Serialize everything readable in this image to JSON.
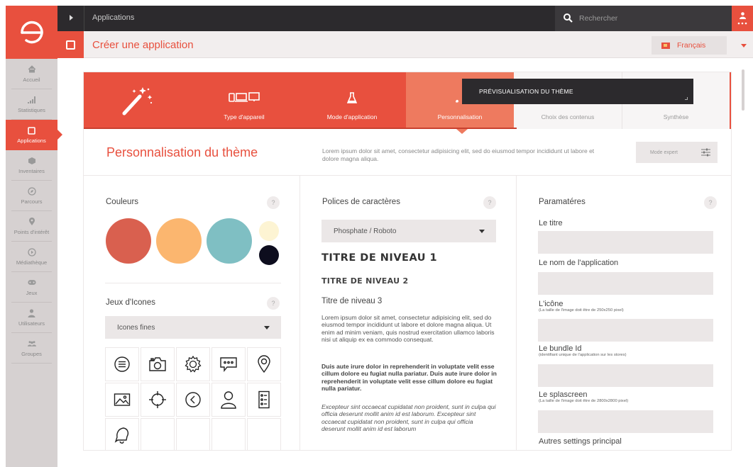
{
  "topbar": {
    "breadcrumb": "Applications",
    "search_placeholder": "Rechercher"
  },
  "subbar": {
    "title": "Créer une application",
    "language": "Français"
  },
  "sidebar": {
    "items": [
      {
        "label": "Accueil",
        "icon": "home-icon"
      },
      {
        "label": "Statistiques",
        "icon": "bar-chart-icon"
      },
      {
        "label": "Applications",
        "icon": "square-icon",
        "active": true
      },
      {
        "label": "Inventaires",
        "icon": "cube-icon"
      },
      {
        "label": "Parcours",
        "icon": "compass-icon"
      },
      {
        "label": "Points d'intérêt",
        "icon": "map-pin-icon"
      },
      {
        "label": "Médiathèque",
        "icon": "play-icon"
      },
      {
        "label": "Jeux",
        "icon": "gamepad-icon"
      },
      {
        "label": "Utilisateurs",
        "icon": "user-icon"
      },
      {
        "label": "Groupes",
        "icon": "group-icon"
      }
    ]
  },
  "wizard": {
    "steps": [
      {
        "label": "Type d'appareil",
        "icon": "devices-icon",
        "state": "done"
      },
      {
        "label": "Mode d'application",
        "icon": "flask-icon",
        "state": "done"
      },
      {
        "label": "Personnalisation",
        "icon": "brush-icon",
        "state": "current"
      },
      {
        "label": "Choix des contenus",
        "icon": "list-icon",
        "state": "todo"
      },
      {
        "label": "Synthèse",
        "icon": "check-icon",
        "state": "todo"
      }
    ],
    "tooltip": "PRÉVISUALISATION DU THÈME"
  },
  "section": {
    "title": "Personnalisation du thème",
    "description": "Lorem ipsum dolor sit amet, consectetur adipisicing elit, sed do eiusmod tempor incididunt ut labore et dolore magna aliqua.",
    "expert_label": "Mode expert"
  },
  "colors": {
    "title": "Couleurs",
    "help": "?",
    "swatches": [
      "#d9604f",
      "#fbb66f",
      "#7fbfc3",
      "#fdf4d3",
      "#0d0d1e"
    ]
  },
  "icons_set": {
    "title": "Jeux d'Icones",
    "help": "?",
    "selected": "Icones fines",
    "icons": [
      "menu-icon",
      "camera-icon",
      "settings-icon",
      "chat-icon",
      "map-pin-icon",
      "image-icon",
      "crosshair-icon",
      "chevron-left-icon",
      "user-icon",
      "list-icon",
      "bell-icon"
    ]
  },
  "fonts": {
    "title": "Polices de caractères",
    "help": "?",
    "selected": "Phosphate / Roboto",
    "h1": "TITRE DE NIVEAU 1",
    "h2": "TITRE DE NIVEAU 2",
    "h3": "Titre de niveau 3",
    "para_regular": "Lorem ipsum dolor sit amet, consectetur adipisicing elit, sed do eiusmod tempor incididunt ut labore et dolore magna aliqua. Ut enim ad minim veniam, quis nostrud exercitation ullamco laboris nisi ut aliquip ex ea commodo consequat.",
    "para_bold": "Duis aute irure dolor in reprehenderit in voluptate velit esse cillum dolore eu fugiat nulla pariatur. Duis aute irure dolor in reprehenderit in voluptate velit esse cillum dolore eu fugiat nulla pariatur.",
    "para_italic": "Excepteur sint occaecat cupidatat non proident, sunt in culpa qui officia deserunt mollit anim id est laborum. Excepteur sint occaecat cupidatat non proident, sunt in culpa qui officia deserunt mollit anim id est laborum"
  },
  "params": {
    "title": "Paramatéres",
    "help": "?",
    "fields": [
      {
        "label": "Le titre",
        "hint": ""
      },
      {
        "label": "Le nom de l'application",
        "hint": ""
      },
      {
        "label": "L'icône",
        "hint": "(La taille de l'image doit être de 250x250 pixel)"
      },
      {
        "label": "Le bundle Id",
        "hint": "(identifiant unique de l'application sur les stores)"
      },
      {
        "label": "Le splascreen",
        "hint": "(La taille de l'image doit être de 2800x2800 pixel)"
      }
    ],
    "footer": "Autres settings principal"
  }
}
